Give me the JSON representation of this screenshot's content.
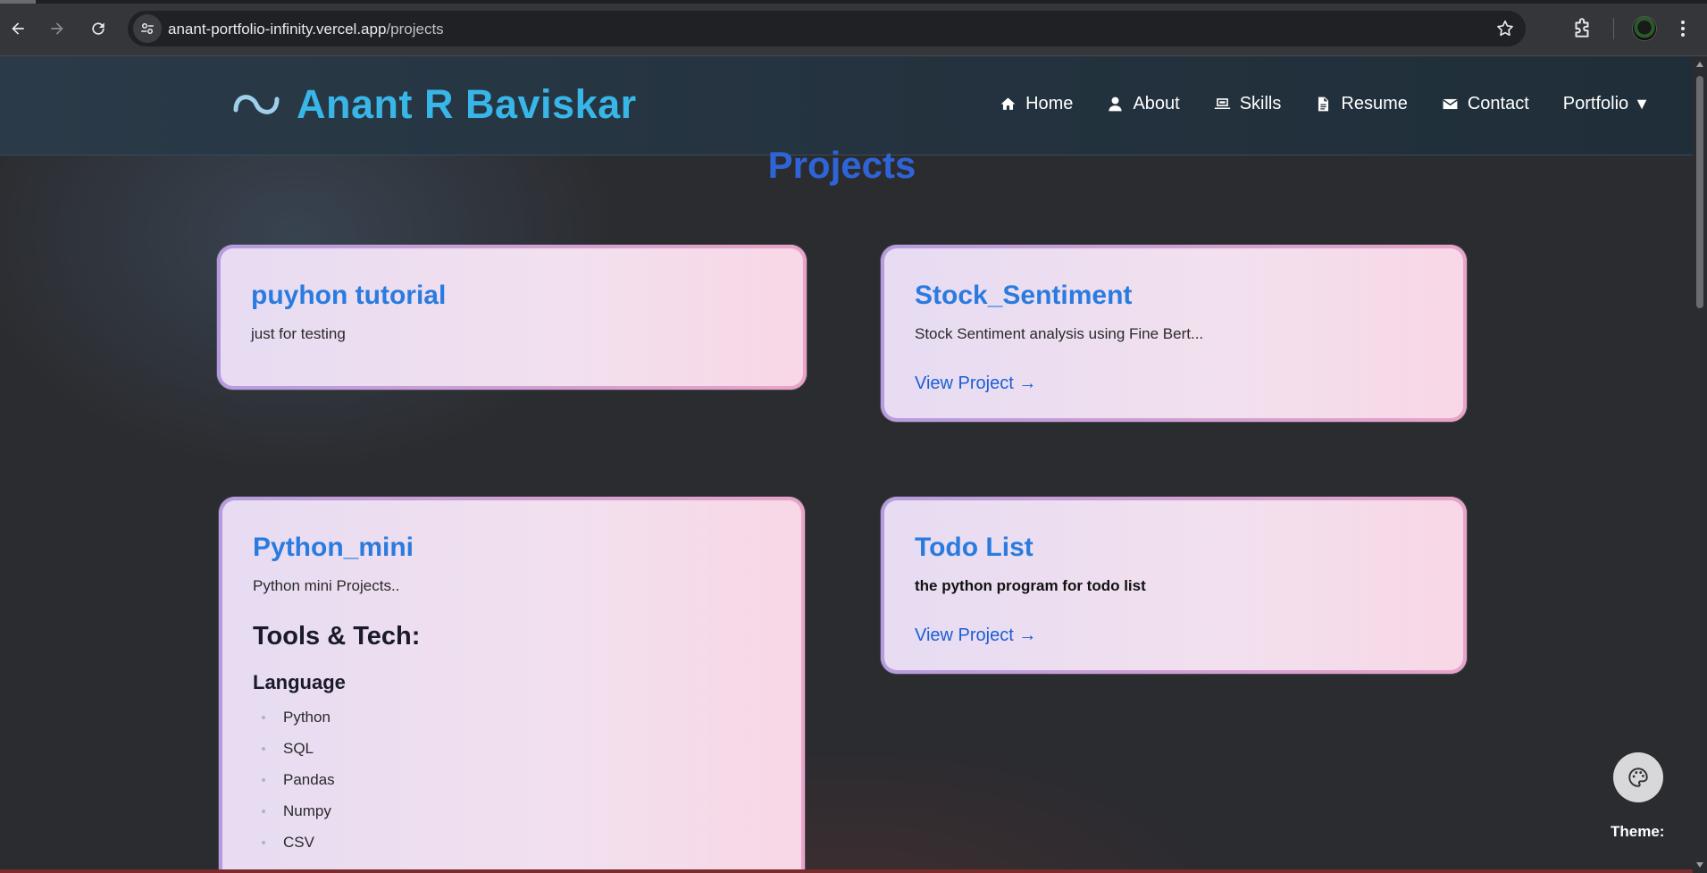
{
  "browser": {
    "url_host": "anant-portfolio-infinity.vercel.app",
    "url_path": "/projects"
  },
  "header": {
    "brand": "Anant R Baviskar",
    "nav": [
      {
        "label": "Home",
        "icon": "home-icon"
      },
      {
        "label": "About",
        "icon": "user-icon"
      },
      {
        "label": "Skills",
        "icon": "laptop-icon"
      },
      {
        "label": "Resume",
        "icon": "document-icon"
      },
      {
        "label": "Contact",
        "icon": "envelope-icon"
      },
      {
        "label": "Portfolio",
        "icon": "caret-down-icon"
      }
    ],
    "portfolio_caret": "▼"
  },
  "page": {
    "title": "Projects"
  },
  "projects": [
    {
      "title": "puyhon tutorial",
      "description": "just for testing"
    },
    {
      "title": "Stock_Sentiment",
      "description": "Stock Sentiment analysis using Fine Bert...",
      "link": "View Project →"
    },
    {
      "title": "Python_mini",
      "description": "Python mini Projects..",
      "tools_heading": "Tools & Tech:",
      "language_heading": "Language",
      "languages": [
        "Python",
        "SQL",
        "Pandas",
        "Numpy",
        "CSV"
      ]
    },
    {
      "title": "Todo List",
      "description": "the python program for todo list",
      "link": "View Project →"
    }
  ],
  "theme": {
    "label": "Theme:",
    "icon": "palette-icon"
  },
  "colors": {
    "brand": "#38b6e8",
    "title": "#2f64d8",
    "card_title": "#2a7be0",
    "link": "#1a5ed6"
  }
}
